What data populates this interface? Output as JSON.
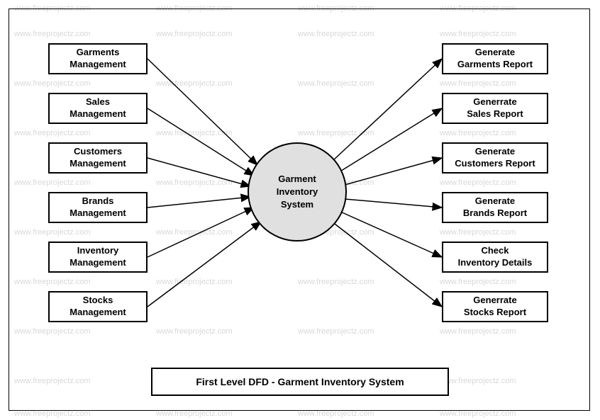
{
  "watermark_text": "www.freeprojectz.com",
  "process": {
    "label": "Garment\nInventory\nSystem"
  },
  "left_entities": [
    {
      "label": "Garments\nManagement"
    },
    {
      "label": "Sales\nManagement"
    },
    {
      "label": "Customers\nManagement"
    },
    {
      "label": "Brands\nManagement"
    },
    {
      "label": "Inventory\nManagement"
    },
    {
      "label": "Stocks\nManagement"
    }
  ],
  "right_entities": [
    {
      "label": "Generate\nGarments Report"
    },
    {
      "label": "Generrate\nSales Report"
    },
    {
      "label": "Generate\nCustomers Report"
    },
    {
      "label": "Generate\nBrands Report"
    },
    {
      "label": "Check\nInventory Details"
    },
    {
      "label": "Generrate\nStocks Report"
    }
  ],
  "title": "First Level DFD - Garment Inventory System",
  "diagram_type": "Data Flow Diagram (Context / First Level)",
  "description": "Six management external entities on the left feed into a central Garment Inventory System process which outputs six reports/details on the right."
}
